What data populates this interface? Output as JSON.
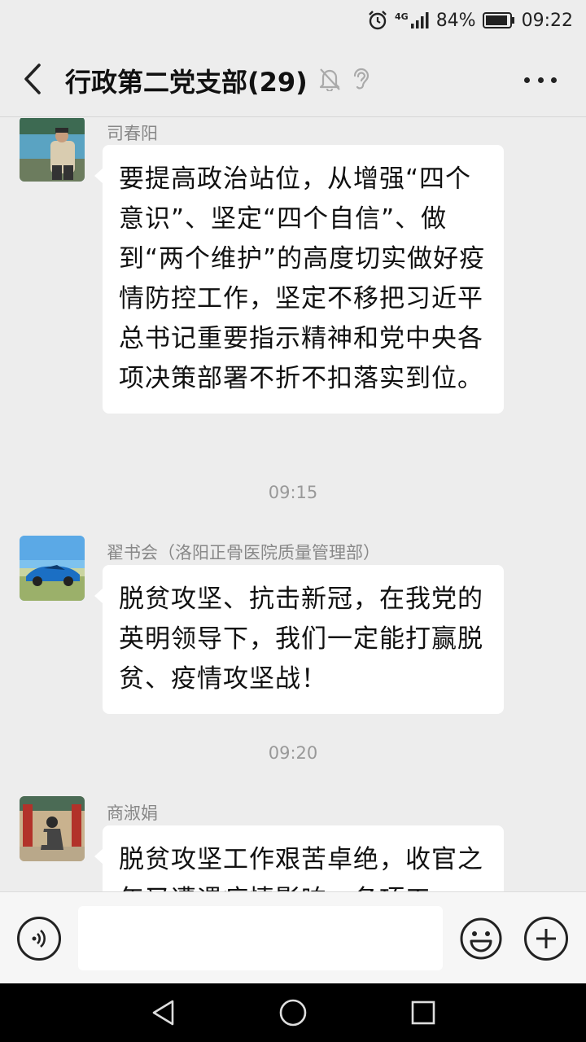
{
  "status_bar": {
    "network": "4G",
    "battery": "84%",
    "time": "09:22",
    "icons": [
      "alarm-icon",
      "signal-icon",
      "battery-icon"
    ]
  },
  "header": {
    "title": "行政第二党支部(29)",
    "icons": [
      "back-icon",
      "mute-icon",
      "ear-icon",
      "more-icon"
    ]
  },
  "messages": [
    {
      "sender": "司春阳",
      "text": "要提高政治站位，从增强“四个意识”、坚定“四个自信”、做到“两个维护”的高度切实做好疫情防控工作，坚定不移把习近平总书记重要指示精神和党中央各项决策部署不折不扣落实到位。",
      "avatar": "avatar-man-lake"
    },
    {
      "timestamp": "09:15"
    },
    {
      "sender": "翟书会（洛阳正骨医院质量管理部）",
      "text": "脱贫攻坚、抗击新冠，在我党的英明领导下，我们一定能打赢脱贫、疫情攻坚战！",
      "avatar": "avatar-blue-car"
    },
    {
      "timestamp": "09:20"
    },
    {
      "sender": "商淑娟",
      "text": "脱贫攻坚工作艰苦卓绝，收官之年又遭遇疫情影响，各项工",
      "avatar": "avatar-temple-woman"
    }
  ],
  "input_bar": {
    "placeholder": "",
    "icons": [
      "voice-icon",
      "emoji-icon",
      "plus-icon"
    ]
  },
  "nav_bar": {
    "icons": [
      "nav-back-icon",
      "nav-home-icon",
      "nav-recent-icon"
    ]
  },
  "colors": {
    "background": "#ededed",
    "bubble": "#ffffff",
    "meta_text": "#888888"
  }
}
